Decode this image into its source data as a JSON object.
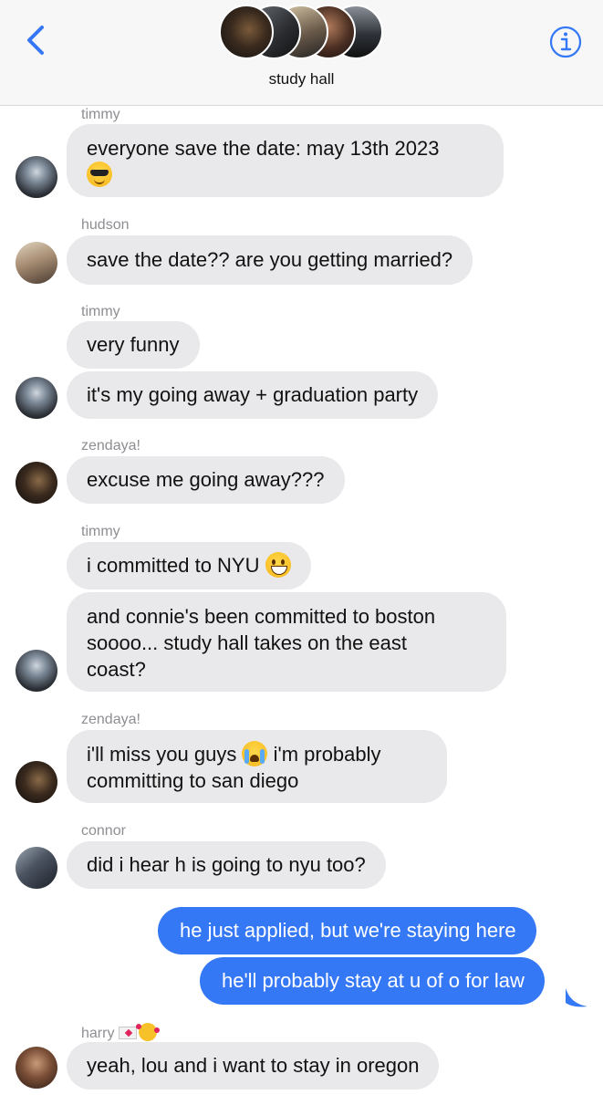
{
  "header": {
    "group_name": "study hall",
    "avatar_count": 5
  },
  "colors": {
    "accent": "#3478f6",
    "incoming_bubble": "#e9e9eb",
    "sender_label": "#8e8e93"
  },
  "messages": [
    {
      "sender": "timmy",
      "text": "everyone save the date: may 13th 2023",
      "emoji": "smiling-face-with-sunglasses"
    },
    {
      "sender": "hudson",
      "text": "save the date?? are you getting married?"
    },
    {
      "sender": "timmy",
      "text": "very funny"
    },
    {
      "text": "it's my going away + graduation party"
    },
    {
      "sender": "zendaya!",
      "text": "excuse me going away???"
    },
    {
      "sender": "timmy",
      "text": "i committed to NYU",
      "emoji": "grinning-face"
    },
    {
      "lines": [
        "and connie's been committed to boston",
        "soooo... study hall takes on the east",
        "coast?"
      ]
    },
    {
      "sender": "zendaya!",
      "line1_before": "i'll miss you guys",
      "line1_after": "i'm probably",
      "line2": "committing to san diego",
      "emoji": "loudly-crying-face"
    },
    {
      "sender": "connor",
      "text": "did i hear h is going to nyu too?"
    },
    {
      "outgoing": true,
      "text": "he just applied, but we're staying here"
    },
    {
      "outgoing": true,
      "text": "he'll probably stay at u of o for law"
    },
    {
      "sender": "harry",
      "sender_emoji": [
        "love-letter",
        "smiling-face-with-hearts"
      ],
      "text": "yeah, lou and i want to stay in oregon"
    }
  ]
}
